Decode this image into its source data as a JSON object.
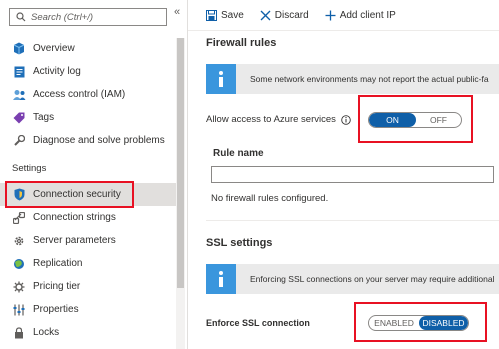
{
  "sidebar": {
    "search_placeholder": "Search (Ctrl+/)",
    "collapse_glyph": "«",
    "items_top": [
      {
        "label": "Overview",
        "icon": "overview-icon"
      },
      {
        "label": "Activity log",
        "icon": "activity-log-icon"
      },
      {
        "label": "Access control (IAM)",
        "icon": "access-control-icon"
      },
      {
        "label": "Tags",
        "icon": "tag-icon"
      },
      {
        "label": "Diagnose and solve problems",
        "icon": "diagnose-icon"
      }
    ],
    "section_label": "Settings",
    "items_settings": [
      {
        "label": "Connection security",
        "icon": "shield-icon",
        "active": true
      },
      {
        "label": "Connection strings",
        "icon": "connection-strings-icon"
      },
      {
        "label": "Server parameters",
        "icon": "gear-icon"
      },
      {
        "label": "Replication",
        "icon": "replication-icon"
      },
      {
        "label": "Pricing tier",
        "icon": "pricing-tier-icon"
      },
      {
        "label": "Properties",
        "icon": "properties-icon"
      },
      {
        "label": "Locks",
        "icon": "lock-icon"
      }
    ]
  },
  "toolbar": {
    "save_label": "Save",
    "discard_label": "Discard",
    "add_client_ip_label": "Add client IP"
  },
  "firewall": {
    "title": "Firewall rules",
    "banner_text": "Some network environments may not report the actual public-fa",
    "allow_label": "Allow access to Azure services",
    "toggle_on": "ON",
    "toggle_off": "OFF",
    "rule_name_header": "Rule name",
    "empty_text": "No firewall rules configured."
  },
  "ssl": {
    "title": "SSL settings",
    "banner_text": "Enforcing SSL connections on your server may require additional",
    "enforce_label": "Enforce SSL connection",
    "toggle_enabled": "ENABLED",
    "toggle_disabled": "DISABLED"
  },
  "colors": {
    "accent": "#0f5fa8",
    "info": "#3a96dd",
    "highlight_border": "#e81123"
  }
}
